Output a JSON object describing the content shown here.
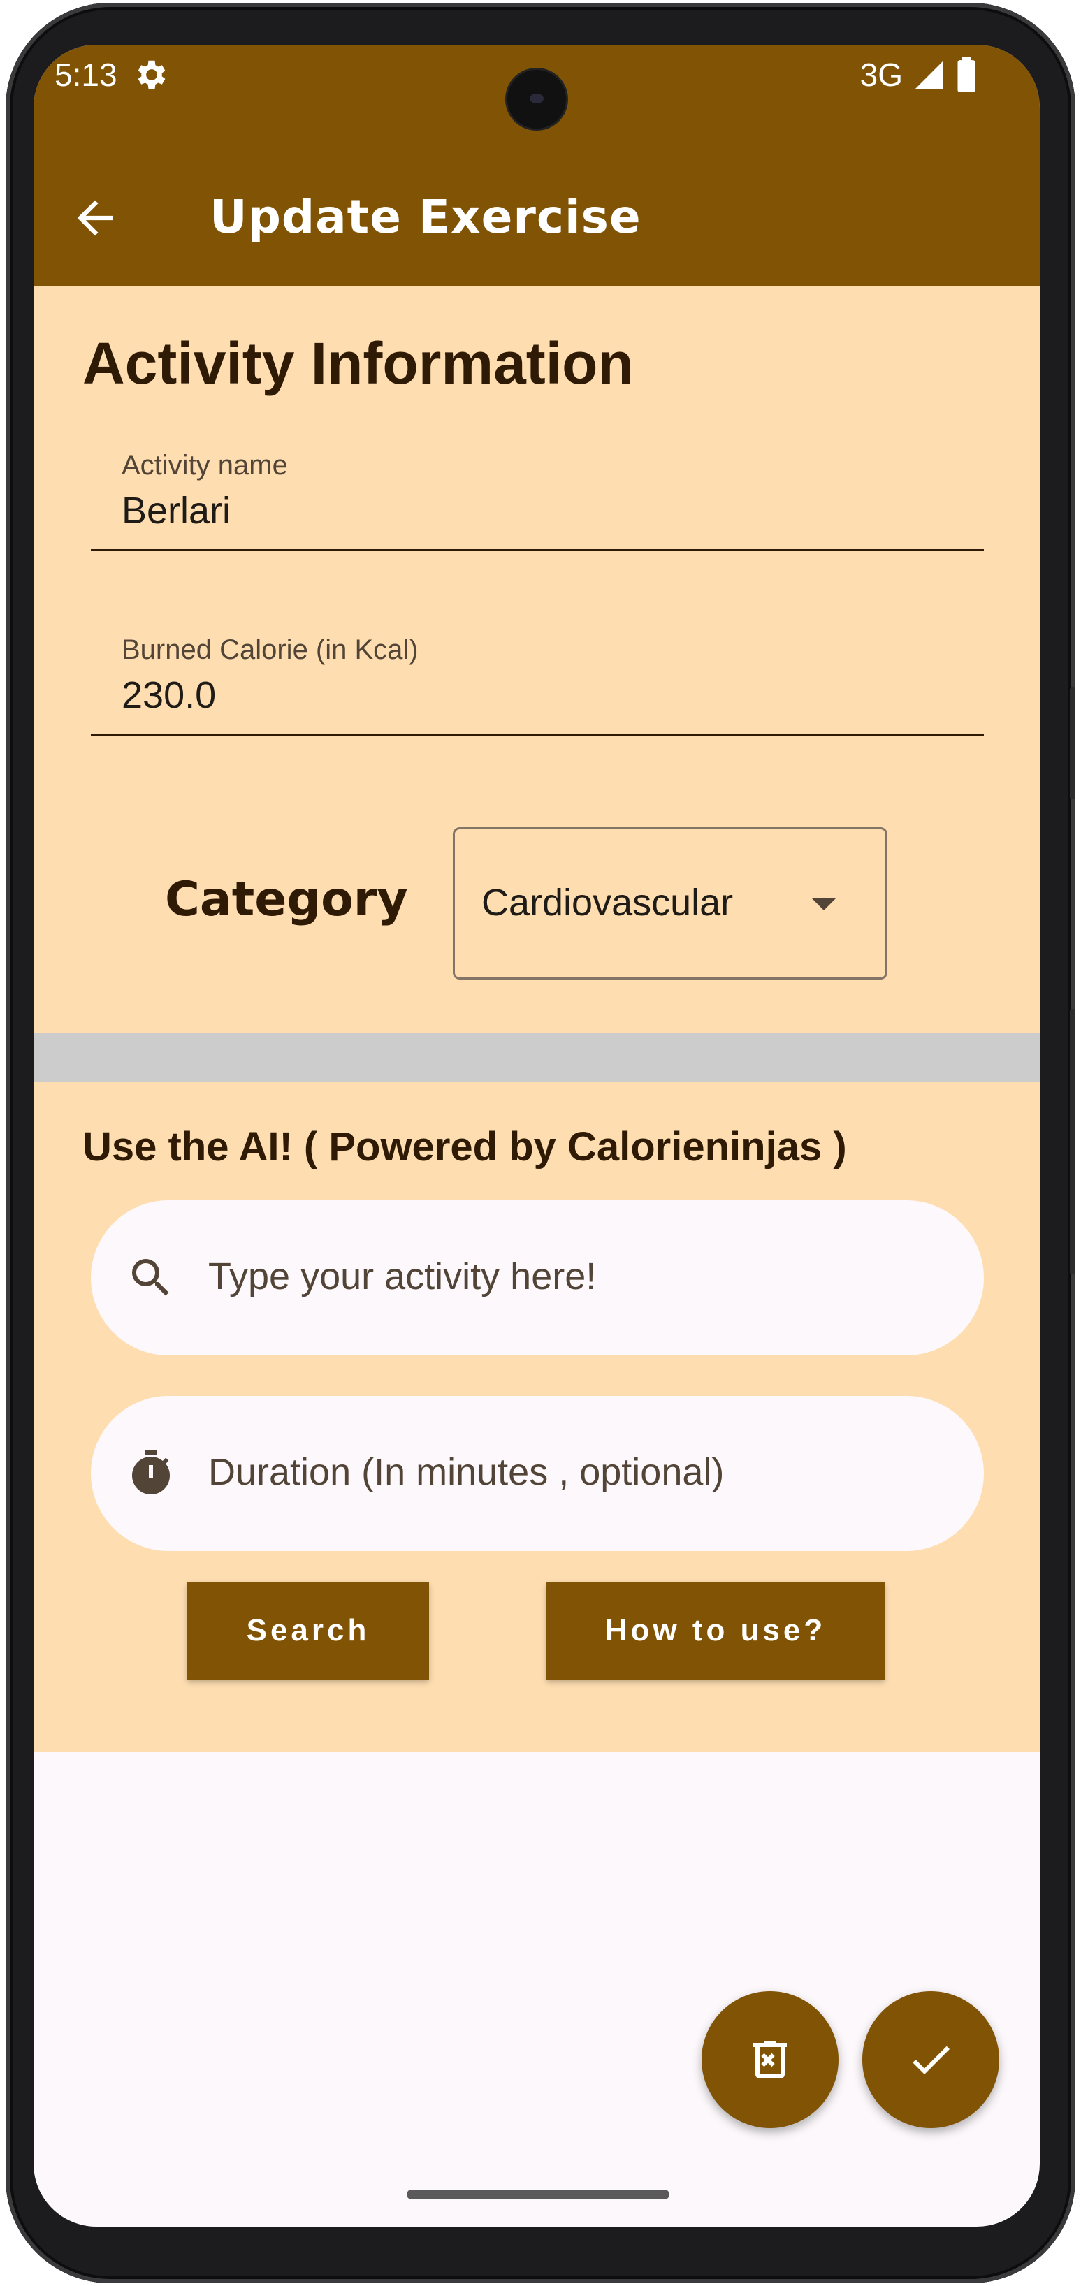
{
  "status_bar": {
    "time": "5:13",
    "network": "3G"
  },
  "app_bar": {
    "title": "Update Exercise"
  },
  "activity_info": {
    "title": "Activity Information",
    "activity_name": {
      "label": "Activity name",
      "value": "Berlari"
    },
    "burned_calorie": {
      "label": "Burned Calorie (in Kcal)",
      "value": "230.0"
    },
    "category": {
      "label": "Category",
      "selected": "Cardiovascular"
    }
  },
  "ai_section": {
    "title": "Use the AI! ( Powered by Calorieninjas )",
    "activity_search": {
      "placeholder": "Type your activity here!"
    },
    "duration": {
      "placeholder": "Duration (In minutes , optional)"
    },
    "search_button": "Search",
    "how_to_use_button": "How to use?"
  },
  "colors": {
    "primary": "#805404",
    "surface": "#fedeb1",
    "on_surface": "#2e1a05",
    "background": "#fcf8fb"
  }
}
